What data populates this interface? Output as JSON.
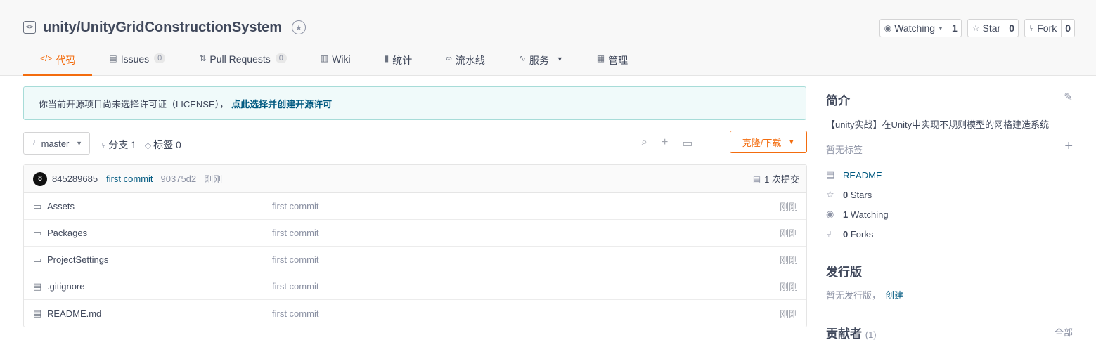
{
  "header": {
    "repo_name": "unity/UnityGridConstructionSystem",
    "actions": [
      {
        "label": "Watching",
        "count": "1",
        "icon": "eye-icon"
      },
      {
        "label": "Star",
        "count": "0",
        "icon": "star-icon"
      },
      {
        "label": "Fork",
        "count": "0",
        "icon": "fork-icon"
      }
    ],
    "tabs": [
      {
        "label": "代码",
        "icon": "code-icon",
        "active": true
      },
      {
        "label": "Issues",
        "count": "0",
        "icon": "issues-icon"
      },
      {
        "label": "Pull Requests",
        "count": "0",
        "icon": "pull-request-icon"
      },
      {
        "label": "Wiki",
        "icon": "book-icon"
      },
      {
        "label": "统计",
        "icon": "chart-icon"
      },
      {
        "label": "流水线",
        "icon": "pipeline-icon"
      },
      {
        "label": "服务",
        "icon": "pulse-icon"
      },
      {
        "label": "管理",
        "icon": "manage-icon"
      }
    ]
  },
  "notice": {
    "text": "你当前开源项目尚未选择许可证（LICENSE），",
    "link": "点此选择并创建开源许可"
  },
  "toolbar": {
    "branch": "master",
    "branches": "分支 1",
    "tags": "标签 0",
    "clone_label": "克隆/下载"
  },
  "commit": {
    "avatar_letter": "8",
    "user": "845289685",
    "message": "first commit",
    "sha": "90375d2",
    "time": "刚刚",
    "count_label": "1 次提交"
  },
  "files": [
    {
      "name": "Assets",
      "type": "folder",
      "message": "first commit",
      "time": "刚刚"
    },
    {
      "name": "Packages",
      "type": "folder",
      "message": "first commit",
      "time": "刚刚"
    },
    {
      "name": "ProjectSettings",
      "type": "folder",
      "message": "first commit",
      "time": "刚刚"
    },
    {
      "name": ".gitignore",
      "type": "file",
      "message": "first commit",
      "time": "刚刚"
    },
    {
      "name": "README.md",
      "type": "file",
      "message": "first commit",
      "time": "刚刚"
    }
  ],
  "sidebar": {
    "intro_title": "简介",
    "description": "【unity实战】在Unity中实现不规则模型的网格建造系统",
    "no_tags": "暂无标签",
    "readme": "README",
    "stars_count": "0",
    "stars_label": "Stars",
    "watching_count": "1",
    "watching_label": "Watching",
    "forks_count": "0",
    "forks_label": "Forks",
    "release_title": "发行版",
    "release_text": "暂无发行版，",
    "release_link": "创建",
    "contributors_title": "贡献者",
    "contributors_count": "(1)",
    "all_label": "全部"
  },
  "colors": {
    "accent": "#f36c0e",
    "link": "#005980",
    "notice_bg": "#f0fafa"
  }
}
